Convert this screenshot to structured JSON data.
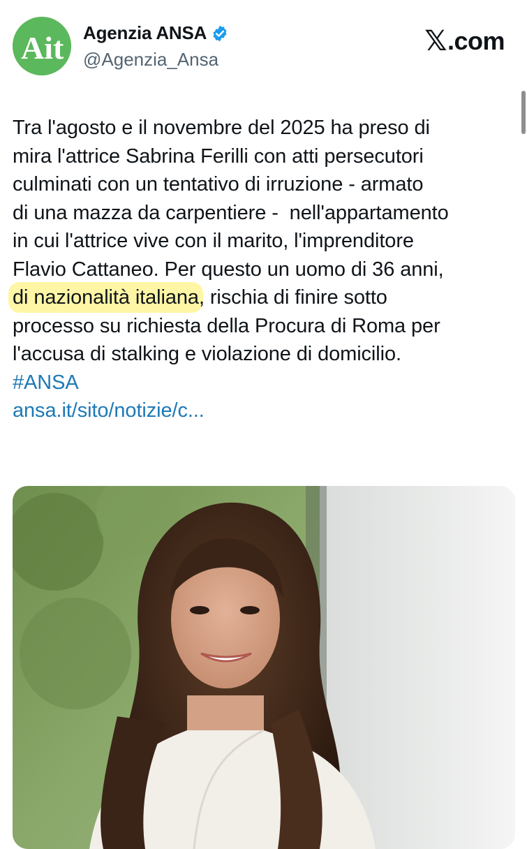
{
  "account": {
    "display_name": "Agenzia ANSA",
    "handle": "@Agenzia_Ansa",
    "avatar_text": "Ait",
    "verified": true
  },
  "brand": {
    "site": ".com",
    "logo_icon": "x-logo-icon"
  },
  "tweet": {
    "line1": "Tra l'agosto e il novembre del 2025 ha preso di",
    "line2": "mira l'attrice Sabrina Ferilli con atti persecutori",
    "line3": "culminati con un tentativo di irruzione - armato",
    "line4": "di una mazza da carpentiere -  nell'appartamento",
    "line5": "in cui l'attrice vive con il marito, l'imprenditore",
    "line6": "Flavio Cattaneo. Per questo un uomo di 36 anni,",
    "line7_highlight": "di nazionalità italiana",
    "line7_rest": ", rischia di finire sotto",
    "line8": "processo su richiesta della Procura di Roma per",
    "line9": "l'accusa di stalking e violazione di domicilio.",
    "hashtag": "#ANSA",
    "link": "ansa.it/sito/notizie/c..."
  },
  "colors": {
    "avatar_bg": "#5cb85c",
    "verified": "#1d9bf0",
    "link": "#1d79b6",
    "highlight": "#fff6a5"
  }
}
